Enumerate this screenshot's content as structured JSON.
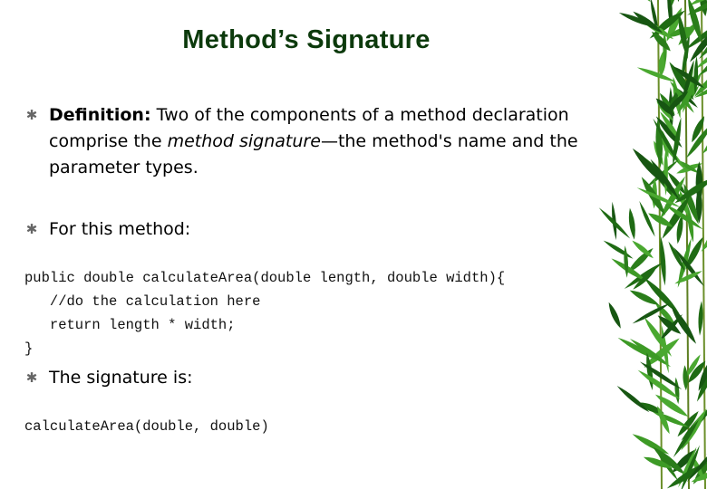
{
  "slide": {
    "title": "Method’s Signature",
    "bullets": [
      {
        "icon": "asterisk-bullet-icon",
        "bold": "Definition:",
        "text_before_italic": " Two of the components of a method declaration comprise the ",
        "italic": "method signature",
        "text_after_italic": "—the method's name and the parameter types."
      },
      {
        "icon": "asterisk-bullet-icon",
        "text": "For this method:"
      },
      {
        "icon": "asterisk-bullet-icon",
        "text": "The signature is:"
      }
    ],
    "code_block": [
      "public double calculateArea(double length, double width){",
      "   //do the calculation here",
      "   return length * width;",
      "}"
    ],
    "signature_code": "calculateArea(double, double)",
    "decoration": "bamboo-leaves",
    "colors": {
      "title": "#0c3a0c",
      "bullet": "#666666",
      "leaf_dark": "#1f6b14",
      "leaf_light": "#3d9a26"
    }
  }
}
